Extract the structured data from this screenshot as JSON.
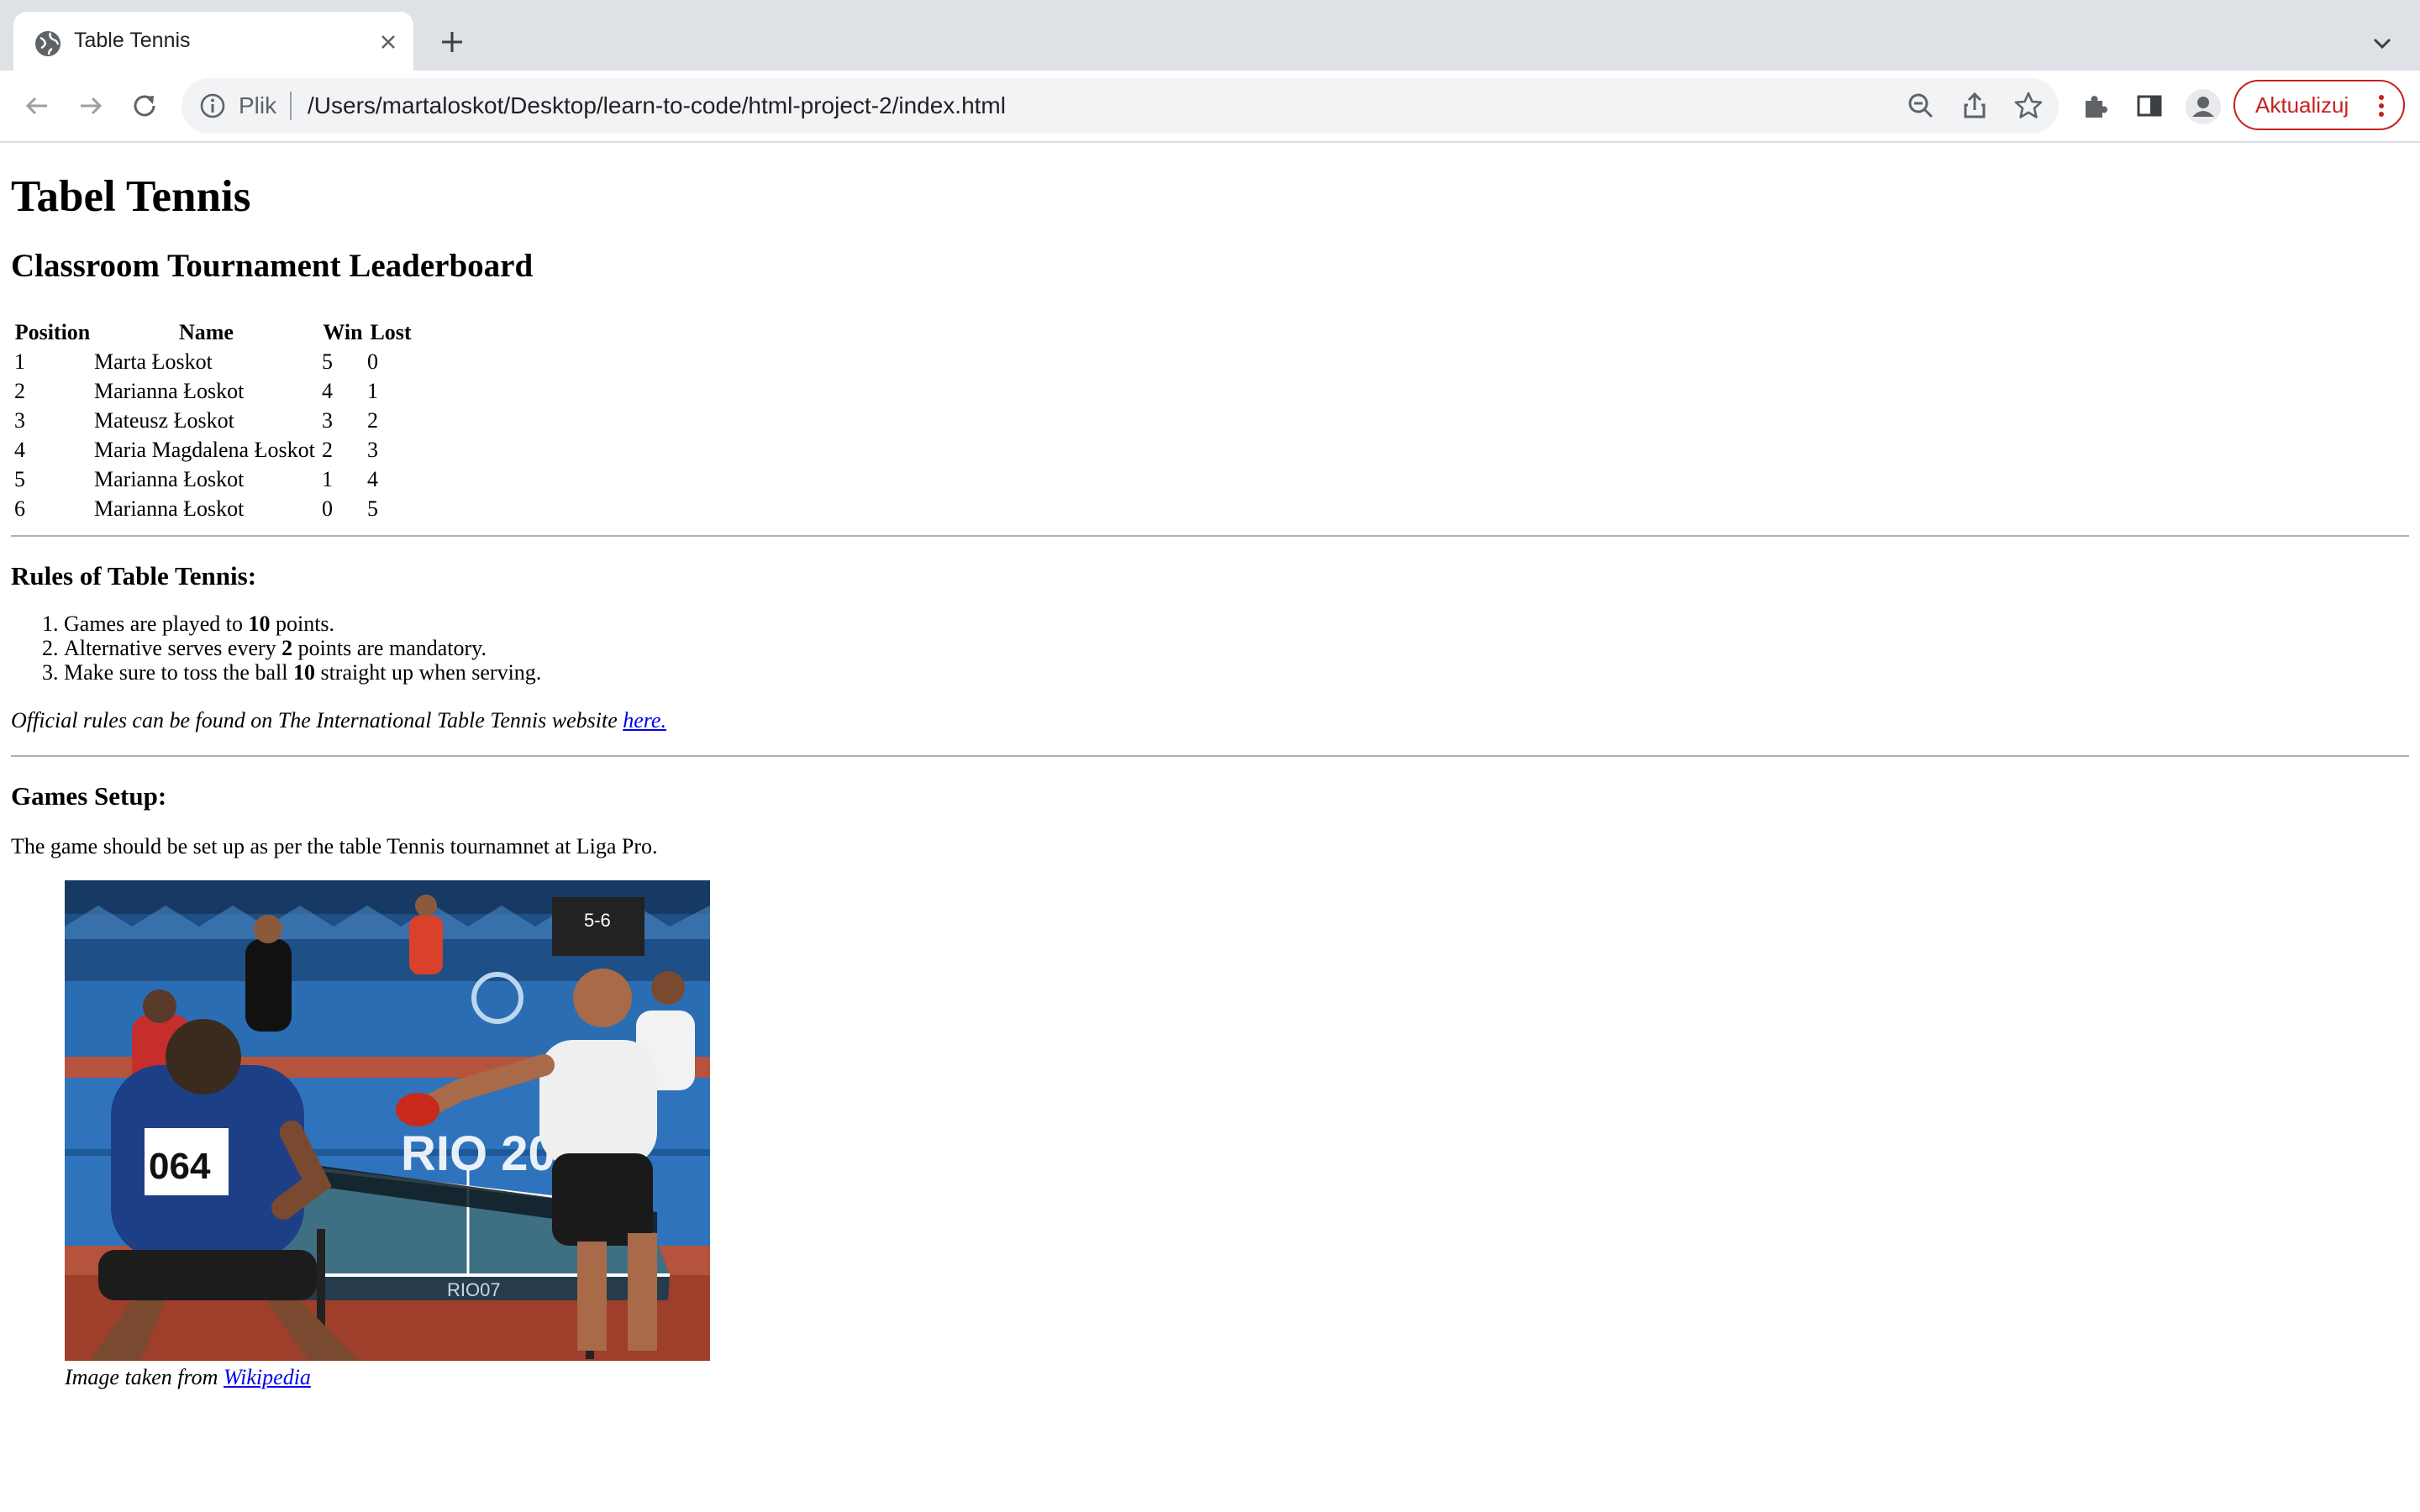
{
  "browser": {
    "tab_title": "Table Tennis",
    "omnibox_scheme": "Plik",
    "url": "/Users/martaloskot/Desktop/learn-to-code/html-project-2/index.html",
    "update_label": "Aktualizuj",
    "accent_color": "#c5221f"
  },
  "page": {
    "title": "Tabel Tennis",
    "subtitle": "Classroom Tournament Leaderboard",
    "table": {
      "headers": [
        "Position",
        "Name",
        "Win",
        "Lost"
      ],
      "rows": [
        [
          "1",
          "Marta Łoskot",
          "5",
          "0"
        ],
        [
          "2",
          "Marianna Łoskot",
          "4",
          "1"
        ],
        [
          "3",
          "Mateusz Łoskot",
          "3",
          "2"
        ],
        [
          "4",
          "Maria Magdalena Łoskot",
          "2",
          "3"
        ],
        [
          "5",
          "Marianna Łoskot",
          "1",
          "4"
        ],
        [
          "6",
          "Marianna Łoskot",
          "0",
          "5"
        ]
      ]
    },
    "rules": {
      "heading": "Rules of Table Tennis:",
      "items": [
        {
          "pre": "Games are played to ",
          "bold": "10",
          "post": " points."
        },
        {
          "pre": "Alternative serves every ",
          "bold": "2",
          "post": " points are mandatory."
        },
        {
          "pre": "Make sure to toss the ball ",
          "bold": "10",
          "post": " straight up when serving."
        }
      ],
      "official_text": "Official rules can be found on The International Table Tennis website ",
      "official_link": "here."
    },
    "setup": {
      "heading": "Games Setup:",
      "text": "The game should be set up as per the table Tennis tournamnet at Liga Pro.",
      "image_alt": "table tennis players at a tournament",
      "caption_text": "Image taken from ",
      "caption_link": "Wikipedia",
      "photo_labels": {
        "bib": "064",
        "banner": "RIO 2007",
        "table_brand": "RIO07",
        "score": "5-6"
      }
    }
  }
}
